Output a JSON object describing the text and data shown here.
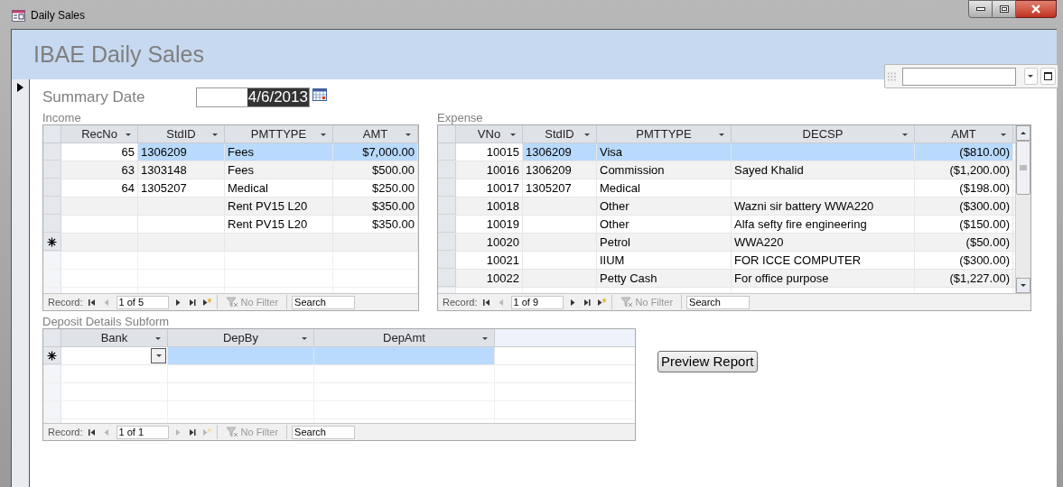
{
  "window": {
    "title": "Daily Sales"
  },
  "header": {
    "title": "IBAE Daily Sales"
  },
  "summary_date": {
    "label": "Summary Date",
    "value": "4/6/2013"
  },
  "income": {
    "label": "Income",
    "columns": [
      {
        "label": "RecNo",
        "kind": "number"
      },
      {
        "label": "StdID",
        "kind": "text"
      },
      {
        "label": "PMTTYPE",
        "kind": "text"
      },
      {
        "label": "AMT",
        "kind": "number"
      }
    ],
    "rows": [
      {
        "cells": [
          "65",
          "1306209",
          "Fees",
          "$7,000.00"
        ],
        "selected": true
      },
      {
        "cells": [
          "63",
          "1303148",
          "Fees",
          "$500.00"
        ],
        "selected": false
      },
      {
        "cells": [
          "64",
          "1305207",
          "Medical",
          "$250.00"
        ],
        "selected": false
      },
      {
        "cells": [
          null,
          null,
          "Rent PV15 L20",
          "$350.00"
        ],
        "selected": false
      },
      {
        "cells": [
          null,
          null,
          "Rent PV15 L20",
          "$350.00"
        ],
        "selected": false
      }
    ],
    "new_row": {
      "selected": false
    },
    "navigator": {
      "label": "Record:",
      "position": "1 of 5",
      "filter": "No Filter",
      "search": "Search"
    }
  },
  "expense": {
    "label": "Expense",
    "columns": [
      {
        "label": "VNo",
        "kind": "number"
      },
      {
        "label": "StdID",
        "kind": "text"
      },
      {
        "label": "PMTTYPE",
        "kind": "text"
      },
      {
        "label": "DECSP",
        "kind": "text"
      },
      {
        "label": "AMT",
        "kind": "number"
      }
    ],
    "rows": [
      {
        "cells": [
          "10015",
          "1306209",
          "Visa",
          null,
          "($810.00)"
        ],
        "selected": true
      },
      {
        "cells": [
          "10016",
          "1306209",
          "Commission",
          "Sayed Khalid",
          "($1,200.00)"
        ],
        "selected": false
      },
      {
        "cells": [
          "10017",
          "1305207",
          "Medical",
          null,
          "($198.00)"
        ],
        "selected": false
      },
      {
        "cells": [
          "10018",
          null,
          "Other",
          "Wazni sir battery WWA220",
          "($300.00)"
        ],
        "selected": false
      },
      {
        "cells": [
          "10019",
          null,
          "Other",
          "Alfa sefty fire engineering",
          "($150.00)"
        ],
        "selected": false
      },
      {
        "cells": [
          "10020",
          null,
          "Petrol",
          "WWA220",
          "($50.00)"
        ],
        "selected": false
      },
      {
        "cells": [
          "10021",
          null,
          "IIUM",
          "FOR ICCE COMPUTER",
          "($300.00)"
        ],
        "selected": false
      },
      {
        "cells": [
          "10022",
          null,
          "Petty Cash",
          "For office purpose",
          "($1,227.00)"
        ],
        "selected": false
      }
    ],
    "navigator": {
      "label": "Record:",
      "position": "1 of 9",
      "filter": "No Filter",
      "search": "Search"
    }
  },
  "deposit": {
    "label": "Deposit Details Subform",
    "columns": [
      {
        "label": "Bank",
        "kind": "combo"
      },
      {
        "label": "DepBy",
        "kind": "text"
      },
      {
        "label": "DepAmt",
        "kind": "number"
      }
    ],
    "new_row": {
      "selected": true
    },
    "navigator": {
      "label": "Record:",
      "position": "1 of 1",
      "filter": "No Filter",
      "search": "Search"
    }
  },
  "preview_button": {
    "label": "Preview Report"
  }
}
